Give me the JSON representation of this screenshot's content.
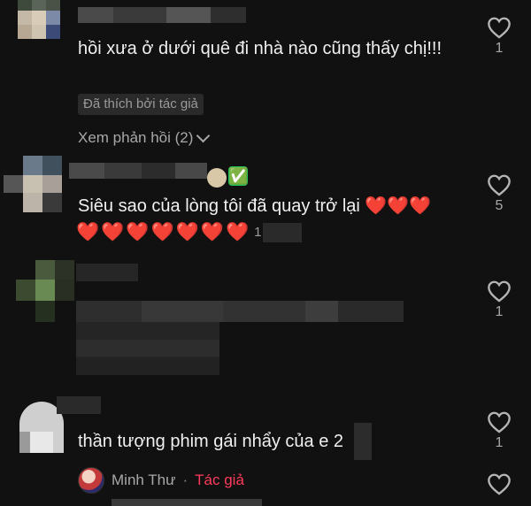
{
  "comments": [
    {
      "text": "hồi xưa ở dưới quê đi nhà nào cũng thấy chị!!!",
      "badge": "Đã thích bởi tác giả",
      "replies": "Xem phản hồi (2)",
      "likes": "1"
    },
    {
      "text": "Siêu sao của lòng tôi đã quay trở lại ❤️❤️❤️",
      "hearts": [
        "❤️",
        "❤️",
        "❤️",
        "❤️",
        "❤️",
        "❤️",
        "❤️"
      ],
      "hearts_suffix": "1",
      "likes": "5",
      "emoji_check": "✅"
    },
    {
      "likes": "1"
    },
    {
      "text": "thần tượng phim gái nhẩy của e 2",
      "likes": "1",
      "author_reply": {
        "name": "Minh Thư",
        "separator": "·",
        "tag": "Tác giả"
      }
    }
  ],
  "colors": {
    "background": "#111111",
    "author_tag": "#ff3b5c",
    "heart": "#ef4444",
    "check": "#22c55e"
  }
}
